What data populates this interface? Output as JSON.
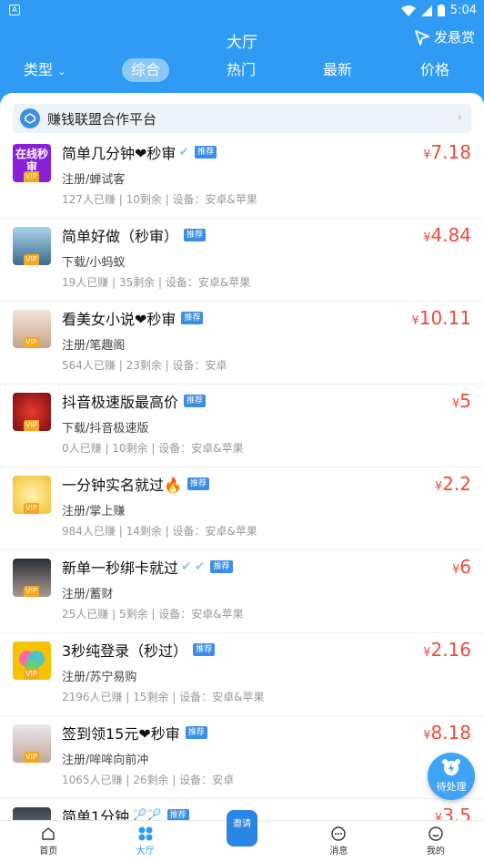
{
  "status": {
    "time": "5:04"
  },
  "header": {
    "title": "大厅",
    "reward_label": "发悬赏"
  },
  "tabs": [
    {
      "label": "类型"
    },
    {
      "label": "综合"
    },
    {
      "label": "热门"
    },
    {
      "label": "最新"
    },
    {
      "label": "价格"
    }
  ],
  "banner": {
    "text": "赚钱联盟合作平台"
  },
  "tag_label": "推荐",
  "vip_label": "VIP",
  "tasks": [
    {
      "title": "简单几分钟❤秒审",
      "sub": "注册/蝉试客",
      "meta": "127人已赚 | 10剩余 | 设备：安卓&苹果",
      "currency": "¥",
      "price": "7.18",
      "thumb_text": "在线秒审"
    },
    {
      "title": "简单好做（秒审）",
      "sub": "下载/小蚂蚁",
      "meta": "19人已赚 | 35剩余 | 设备：安卓&苹果",
      "currency": "¥",
      "price": "4.84"
    },
    {
      "title": "看美女小说❤秒审",
      "sub": "注册/笔趣阁",
      "meta": "564人已赚 | 23剩余 | 设备：安卓",
      "currency": "¥",
      "price": "10.11"
    },
    {
      "title": "抖音极速版最高价",
      "sub": "下载/抖音极速版",
      "meta": "0人已赚 | 10剩余 | 设备：安卓&苹果",
      "currency": "¥",
      "price": "5"
    },
    {
      "title": "一分钟实名就过🔥",
      "sub": "注册/掌上赚",
      "meta": "984人已赚 | 14剩余 | 设备：安卓&苹果",
      "currency": "¥",
      "price": "2.2"
    },
    {
      "title": "新单一秒绑卡就过",
      "sub": "注册/蓄财",
      "meta": "25人已赚 | 5剩余 | 设备：安卓&苹果",
      "currency": "¥",
      "price": "6"
    },
    {
      "title": "3秒纯登录（秒过）",
      "sub": "注册/苏宁易购",
      "meta": "2196人已赚 | 15剩余 | 设备：安卓&苹果",
      "currency": "¥",
      "price": "2.16"
    },
    {
      "title": "签到领15元❤秒审",
      "sub": "注册/哞哞向前冲",
      "meta": "1065人已赚 | 26剩余 | 设备：安卓",
      "currency": "¥",
      "price": "8.18"
    },
    {
      "title": "简单1分钟",
      "sub": "",
      "meta": "",
      "currency": "¥",
      "price": "3.5"
    }
  ],
  "float_button": {
    "label": "待处理"
  },
  "bottom_nav": [
    {
      "label": "首页"
    },
    {
      "label": "大厅"
    },
    {
      "label": "邀请"
    },
    {
      "label": "消息"
    },
    {
      "label": "我的"
    }
  ],
  "colors": {
    "primary": "#2f9bf4",
    "price": "#f04a3a",
    "tag": "#3b8ee8",
    "vip": "#f6a623"
  }
}
